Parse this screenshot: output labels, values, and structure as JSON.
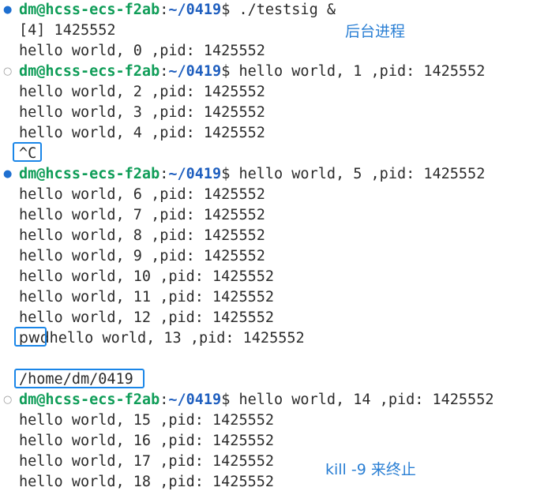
{
  "prompt": {
    "user_host": "dm@hcss-ecs-f2ab",
    "colon": ":",
    "path": "~/0419",
    "dollar": "$ "
  },
  "markers": {
    "filled": "●",
    "hollow": "○"
  },
  "lines": [
    {
      "t": "./testsig &"
    },
    {
      "t": "[4] 1425552"
    },
    {
      "t": "hello world, 0 ,pid: 1425552"
    },
    {
      "t": "hello world, 1 ,pid: 1425552"
    },
    {
      "t": "hello world, 2 ,pid: 1425552"
    },
    {
      "t": "hello world, 3 ,pid: 1425552"
    },
    {
      "t": "hello world, 4 ,pid: 1425552"
    },
    {
      "t": "^C"
    },
    {
      "t": "hello world, 5 ,pid: 1425552"
    },
    {
      "t": "hello world, 6 ,pid: 1425552"
    },
    {
      "t": "hello world, 7 ,pid: 1425552"
    },
    {
      "t": "hello world, 8 ,pid: 1425552"
    },
    {
      "t": "hello world, 9 ,pid: 1425552"
    },
    {
      "t": "hello world, 10 ,pid: 1425552"
    },
    {
      "t": "hello world, 11 ,pid: 1425552"
    },
    {
      "t": "hello world, 12 ,pid: 1425552"
    },
    {
      "t": "pwd"
    },
    {
      "t": "hello world, 13 ,pid: 1425552"
    },
    {
      "t": ""
    },
    {
      "t": "/home/dm/0419"
    },
    {
      "t": "hello world, 14 ,pid: 1425552"
    },
    {
      "t": "hello world, 15 ,pid: 1425552"
    },
    {
      "t": "hello world, 16 ,pid: 1425552"
    },
    {
      "t": "hello world, 17 ,pid: 1425552"
    },
    {
      "t": "hello world, 18 ,pid: 1425552"
    }
  ],
  "annotations": {
    "background_process": "后台进程",
    "kill_note": "kill -9 来终止"
  },
  "colors": {
    "prompt_user": "#0f9d58",
    "prompt_path": "#1f5fbf",
    "highlight_box": "#1a86e8",
    "annotation": "#2a7fd4",
    "marker_active": "#1e6fd0",
    "marker_inactive": "#9a9a9a"
  }
}
